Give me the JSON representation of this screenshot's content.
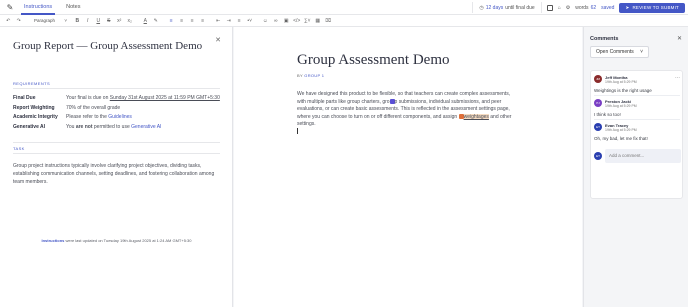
{
  "topbar": {
    "tabs": [
      "Instructions",
      "Notes"
    ],
    "due_days": "12 days",
    "due_suffix": "until final due",
    "words_label": "words",
    "word_count": "62",
    "saved_label": "saved",
    "review_label": "REVIEW TO SUBMIT"
  },
  "toolbar": {
    "paragraph": "Paragraph"
  },
  "instructions": {
    "title": "Group Report — Group Assessment Demo",
    "requirements_heading": "REQUIREMENTS",
    "final_due_key": "Final Due",
    "final_due_prefix": "Your final is due on ",
    "final_due_date": "Sunday 31st August 2025 at 11:59 PM GMT+5:30",
    "report_weighting_key": "Report Weighting",
    "report_weighting_value": "70% of the overall grade",
    "academic_integrity_key": "Academic Integrity",
    "academic_integrity_prefix": "Please refer to the ",
    "academic_integrity_link": "Guidelines",
    "generative_ai_key": "Generative AI",
    "generative_ai_you": "You ",
    "generative_ai_not": "are not",
    "generative_ai_middle": " permitted to use ",
    "generative_ai_link": "Generative AI",
    "task_heading": "TASK",
    "task_text": "Group project instructions typically involve clarifying project objectives, dividing tasks, establishing communication channels, setting deadlines, and fostering collaboration among team members.",
    "updated_label": "Instructions",
    "updated_text": " were last updated on Tuesday 19th August 2025 at 1:24 AM GMT+5:30"
  },
  "document": {
    "title": "Group Assessment Demo",
    "byline_prefix": "BY ",
    "byline_group": "GROUP 1",
    "p1": "We have designed this product to be flexible, so that teachers can create complex assessments, with multiple parts like group charters, gro",
    "p2": "p submissions, individual submissions, and peer evaluations, or can create basic assessments. This is reflected in the assessment settings page, where you can choose to turn on or off different components, and assign ",
    "p3": "weightages",
    "p4": " and other settings."
  },
  "comments": {
    "title": "Comments",
    "filter": "Open Comments",
    "items": [
      {
        "initials": "JM",
        "name": "Jeff Montha",
        "time": "19th Aug at 5:29 PM",
        "text": "Weightings is the right usage",
        "color": "#8a2b2b"
      },
      {
        "initials": "PJ",
        "name": "Preston Jacki",
        "time": "19th Aug at 5:29 PM",
        "text": "I think so too!",
        "color": "#7a3fc4"
      },
      {
        "initials": "ET",
        "name": "Evan Tracey",
        "time": "19th Aug at 5:29 PM",
        "text": "Oh, my bad, let me fix that!",
        "color": "#2a3fb0"
      }
    ],
    "add_placeholder": "Add a comment...",
    "me_initials": "ET",
    "me_color": "#2a3fb0"
  },
  "colors": {
    "accent": "#4457c6"
  }
}
